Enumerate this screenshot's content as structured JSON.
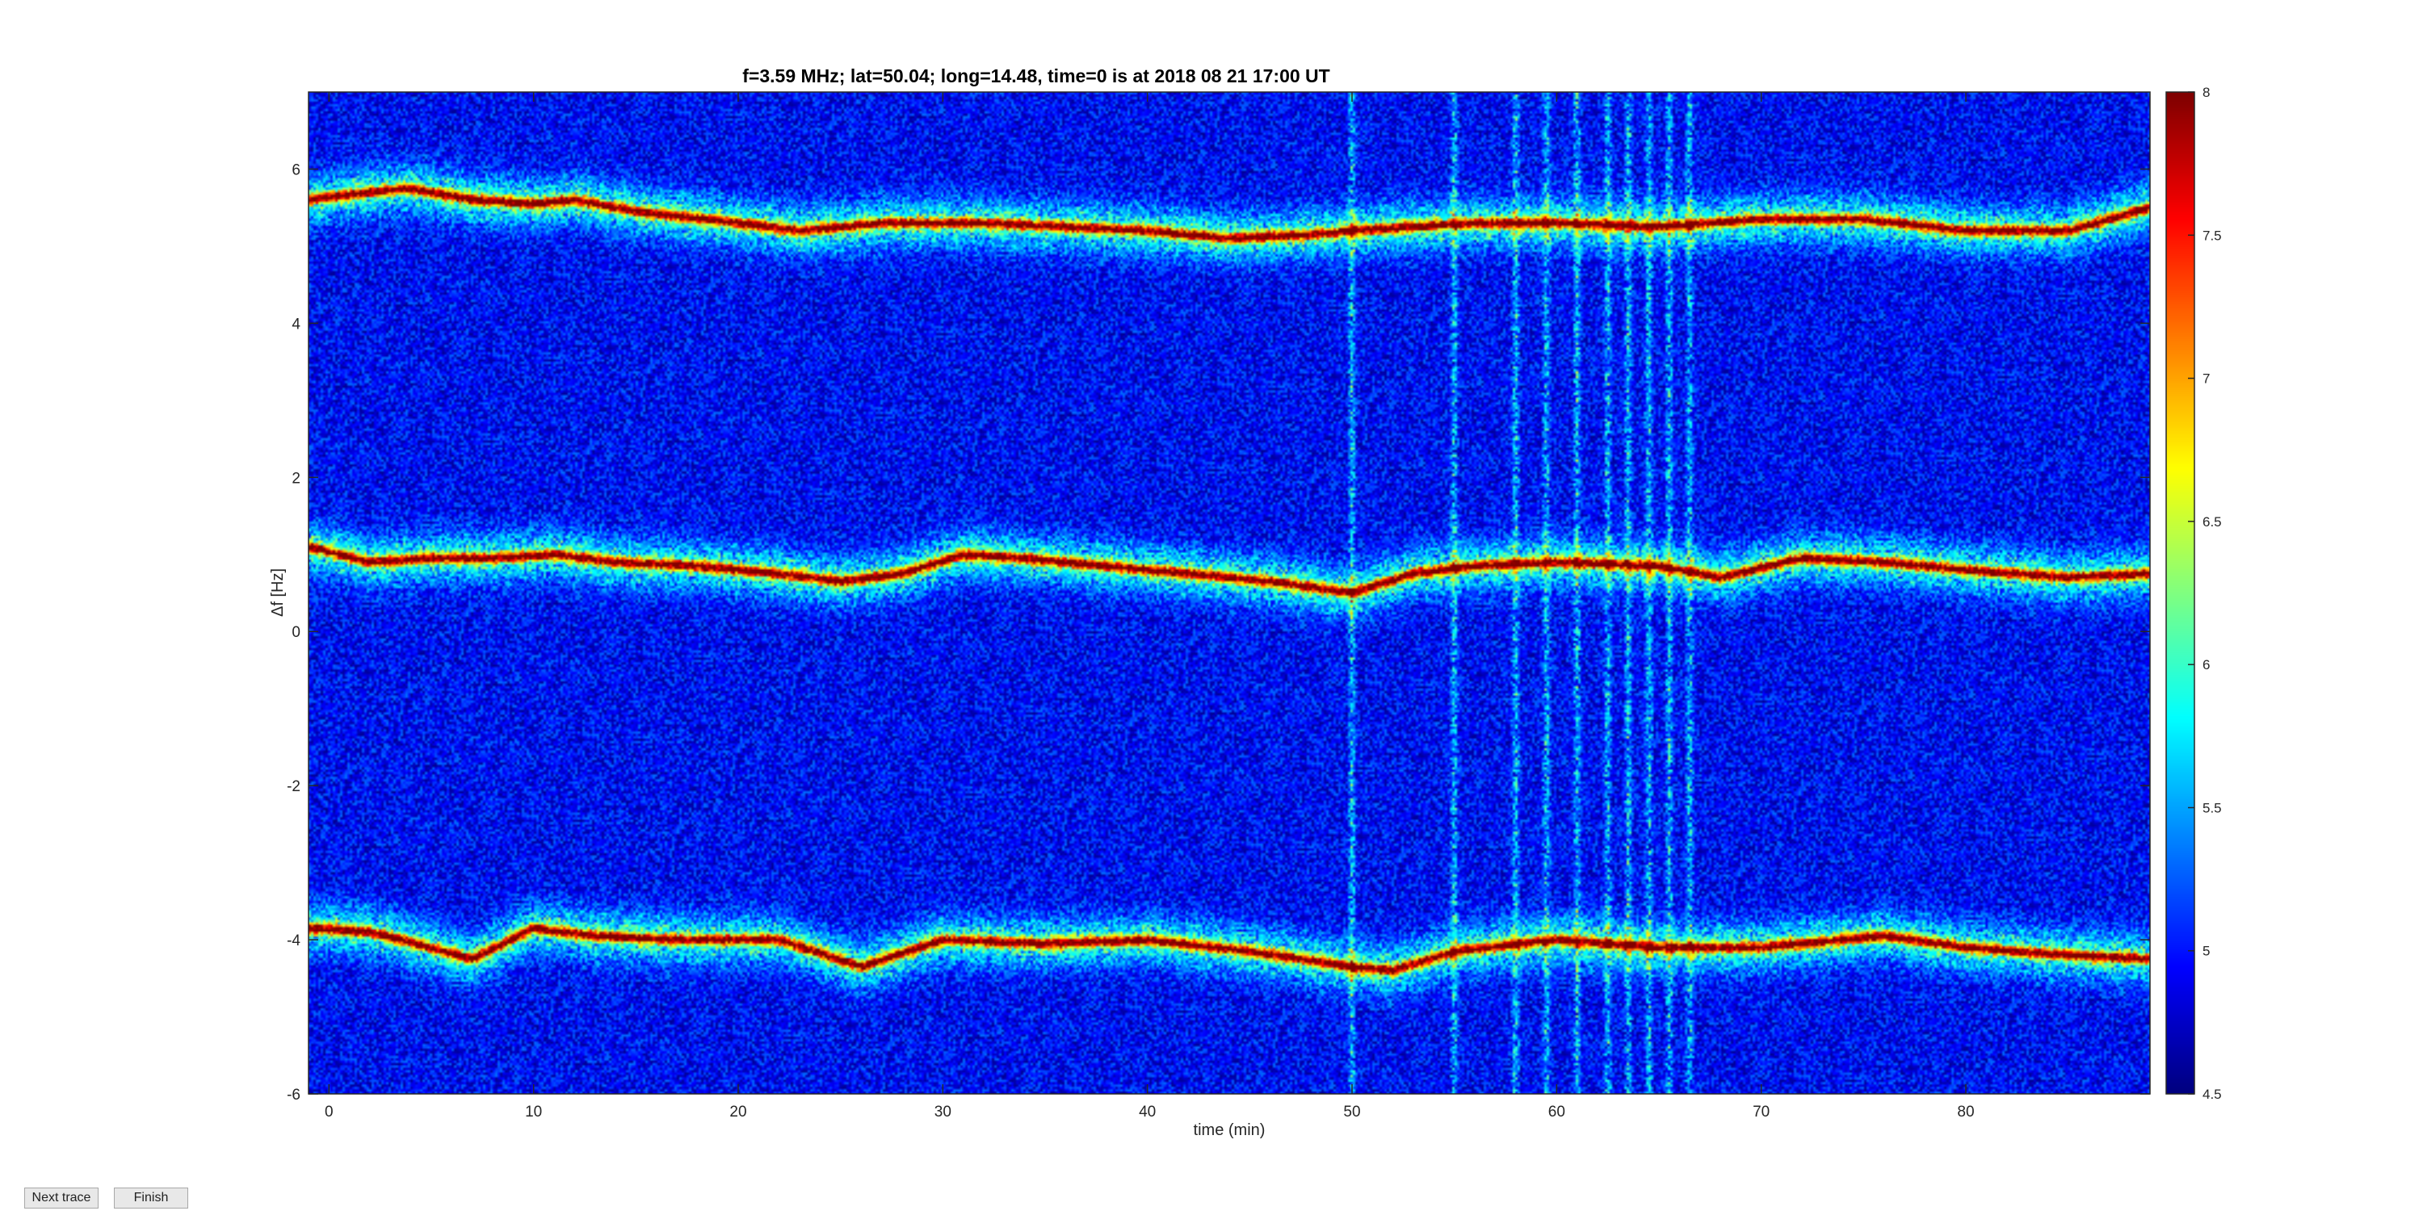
{
  "window": {},
  "buttons": {
    "next_trace": "Next trace",
    "finish": "Finish"
  },
  "chart_data": {
    "type": "heatmap",
    "title": "f=3.59 MHz;  lat=50.04; long=14.48, time=0 is at 2018 08 21 17:00 UT",
    "xlabel": "time (min)",
    "ylabel": "Δf [Hz]",
    "xlim": [
      -1,
      89
    ],
    "ylim": [
      -6,
      7
    ],
    "xticks": [
      0,
      10,
      20,
      30,
      40,
      50,
      60,
      70,
      80
    ],
    "yticks": [
      -6,
      -4,
      -2,
      0,
      2,
      4,
      6
    ],
    "colorbar": {
      "colormap": "jet",
      "clim": [
        4.5,
        8
      ],
      "ticks": [
        "4.5",
        "5",
        "5.5",
        "6",
        "6.5",
        "7",
        "7.5",
        "8"
      ]
    },
    "background_level": 4.9,
    "series": [
      {
        "x": [
          -1,
          2,
          4,
          7,
          10,
          12,
          15,
          20,
          23,
          27,
          32,
          36,
          40,
          44,
          48,
          50,
          53,
          56,
          60,
          65,
          70,
          75,
          80,
          85,
          89
        ],
        "y": [
          5.6,
          5.7,
          5.75,
          5.6,
          5.55,
          5.6,
          5.45,
          5.3,
          5.2,
          5.3,
          5.3,
          5.25,
          5.2,
          5.1,
          5.15,
          5.2,
          5.25,
          5.3,
          5.3,
          5.25,
          5.35,
          5.35,
          5.2,
          5.2,
          5.5
        ]
      },
      {
        "x": [
          -1,
          2,
          5,
          8,
          11,
          14,
          18,
          22,
          25,
          28,
          31,
          34,
          38,
          42,
          46,
          50,
          53,
          56,
          60,
          65,
          68,
          72,
          76,
          80,
          85,
          89
        ],
        "y": [
          1.1,
          0.9,
          0.95,
          0.95,
          1.0,
          0.9,
          0.85,
          0.75,
          0.65,
          0.75,
          1.0,
          0.95,
          0.85,
          0.75,
          0.65,
          0.5,
          0.75,
          0.85,
          0.9,
          0.85,
          0.7,
          0.95,
          0.9,
          0.8,
          0.7,
          0.75
        ]
      },
      {
        "x": [
          -1,
          2,
          5,
          7,
          10,
          13,
          17,
          22,
          26,
          30,
          35,
          40,
          45,
          50,
          52,
          55,
          60,
          65,
          70,
          76,
          80,
          85,
          89
        ],
        "y": [
          -3.85,
          -3.9,
          -4.1,
          -4.25,
          -3.85,
          -3.95,
          -4.0,
          -4.0,
          -4.35,
          -4.0,
          -4.05,
          -4.0,
          -4.15,
          -4.35,
          -4.4,
          -4.15,
          -4.0,
          -4.1,
          -4.1,
          -3.95,
          -4.1,
          -4.2,
          -4.25
        ]
      }
    ],
    "vertical_streaks_minutes": [
      50,
      55,
      58,
      59.5,
      61,
      62.5,
      63.5,
      64.5,
      65.5,
      66.5
    ]
  }
}
